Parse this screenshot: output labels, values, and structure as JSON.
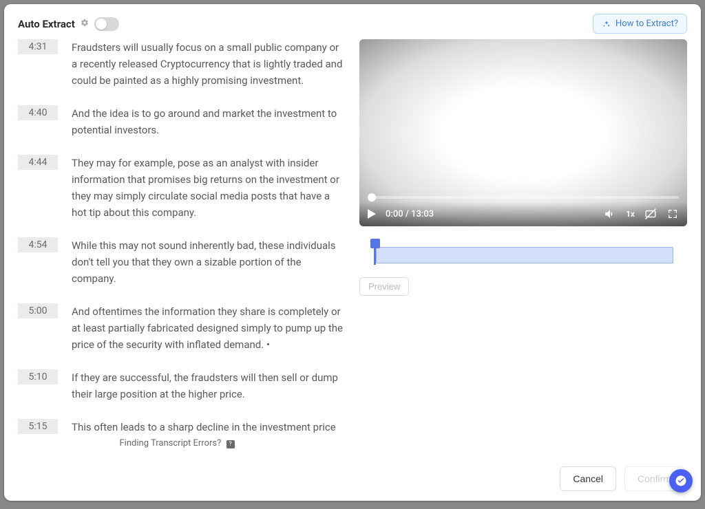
{
  "header": {
    "title": "Auto Extract",
    "how_to_label": "How to Extract?"
  },
  "transcript": [
    {
      "time": "4:31",
      "text": "Fraudsters will usually focus on a small public company or a recently released Cryptocurrency that is lightly traded and could be painted as a highly promising investment."
    },
    {
      "time": "4:40",
      "text": "And the idea is to go around and market the investment to potential investors."
    },
    {
      "time": "4:44",
      "text": "They may for example, pose as an analyst with insider information that promises big returns on the investment or they may simply circulate social media posts that have a hot tip about this company."
    },
    {
      "time": "4:54",
      "text": "While this may not sound inherently bad, these individuals don't tell you that they own a sizable portion of the company."
    },
    {
      "time": "5:00",
      "text": "And oftentimes the information they share is completely or at least partially fabricated designed simply to pump up the price of the security with inflated demand. •"
    },
    {
      "time": "5:10",
      "text": "If they are successful, the fraudsters will then sell or dump their large position at the higher price."
    },
    {
      "time": "5:15",
      "text": "This often leads to a sharp decline in the investment price as they sell a large chunk of the security leaving"
    }
  ],
  "transcript_footer": "Finding Transcript Errors?",
  "video": {
    "current_time": "0:00",
    "duration": "13:03",
    "speed": "1x"
  },
  "preview_label": "Preview",
  "footer": {
    "cancel": "Cancel",
    "confirm": "Confirm"
  }
}
